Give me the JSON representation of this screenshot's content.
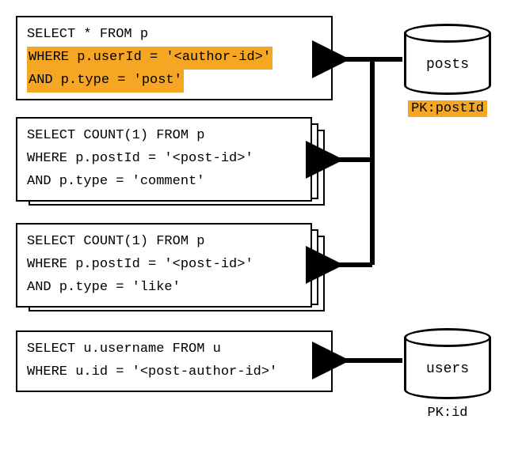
{
  "queries": {
    "q1": {
      "line1": "SELECT * FROM p",
      "line2": "WHERE p.userId = '<author-id>'",
      "line3": "AND p.type = 'post'"
    },
    "q2": {
      "line1": "SELECT COUNT(1) FROM p",
      "line2": "WHERE p.postId = '<post-id>'",
      "line3": "AND p.type = 'comment'"
    },
    "q3": {
      "line1": "SELECT COUNT(1) FROM p",
      "line2": "WHERE p.postId = '<post-id>'",
      "line3": "AND p.type = 'like'"
    },
    "q4": {
      "line1": "SELECT u.username FROM u",
      "line2": "WHERE u.id = '<post-author-id>'"
    }
  },
  "databases": {
    "posts": {
      "label": "posts",
      "pk_prefix": "PK:",
      "pk_value": "postId"
    },
    "users": {
      "label": "users",
      "pk_prefix": "PK:",
      "pk_value": "id"
    }
  },
  "colors": {
    "highlight": "#f5a623"
  }
}
